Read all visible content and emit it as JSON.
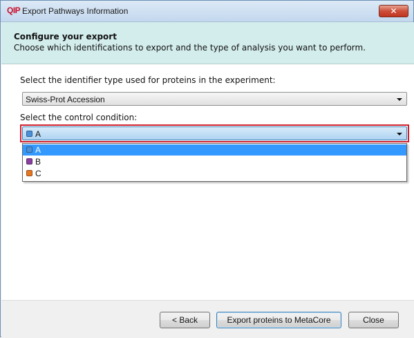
{
  "window": {
    "title": "Export Pathways Information",
    "app_logo_text": "QIP"
  },
  "header": {
    "title": "Configure your export",
    "subtitle": "Choose which identifications to export and the type of analysis you want to perform."
  },
  "identifier": {
    "label": "Select the identifier type used for proteins in the experiment:",
    "selected": "Swiss-Prot Accession"
  },
  "control": {
    "label": "Select the control condition:",
    "selected": "A",
    "selected_color": "#4a90d9",
    "options": [
      {
        "label": "A",
        "color": "#4a90d9"
      },
      {
        "label": "B",
        "color": "#8b3fa0"
      },
      {
        "label": "C",
        "color": "#e87722"
      }
    ]
  },
  "footer": {
    "back_label": "< Back",
    "export_label": "Export proteins to MetaCore",
    "close_label": "Close"
  },
  "colors": {
    "header_bg": "#d3ecec",
    "highlight_outline": "#d01f2d",
    "selection_bg": "#3399ff"
  }
}
